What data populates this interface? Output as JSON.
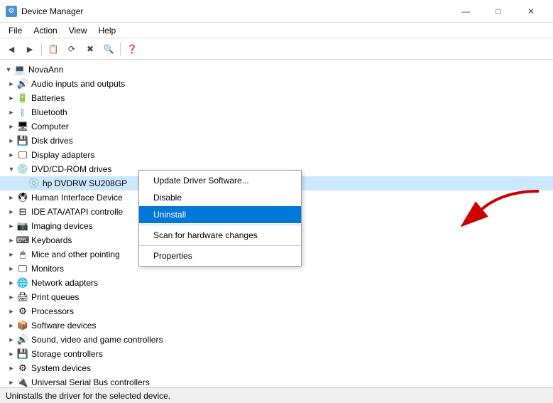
{
  "titleBar": {
    "title": "Device Manager",
    "iconSymbol": "⚙",
    "minimize": "—",
    "maximize": "□",
    "close": "✕"
  },
  "menuBar": {
    "items": [
      "File",
      "Action",
      "View",
      "Help"
    ]
  },
  "toolbar": {
    "buttons": [
      "←",
      "→",
      "⊡",
      "⊟",
      "⊞",
      "⊠",
      "↺",
      "⬛",
      "🖨",
      "⚙",
      "?"
    ]
  },
  "tree": {
    "items": [
      {
        "id": "novaann",
        "label": "NovaAnn",
        "indent": 0,
        "expand": "▼",
        "icon": "💻"
      },
      {
        "id": "audio",
        "label": "Audio inputs and outputs",
        "indent": 1,
        "expand": "►",
        "icon": "🔊"
      },
      {
        "id": "batteries",
        "label": "Batteries",
        "indent": 1,
        "expand": "►",
        "icon": "🔋"
      },
      {
        "id": "bluetooth",
        "label": "Bluetooth",
        "indent": 1,
        "expand": "►",
        "icon": "⬡"
      },
      {
        "id": "computer",
        "label": "Computer",
        "indent": 1,
        "expand": "►",
        "icon": "🖥"
      },
      {
        "id": "diskdrives",
        "label": "Disk drives",
        "indent": 1,
        "expand": "►",
        "icon": "💾"
      },
      {
        "id": "displayadapters",
        "label": "Display adapters",
        "indent": 1,
        "expand": "►",
        "icon": "🖵"
      },
      {
        "id": "dvdcdrom",
        "label": "DVD/CD-ROM drives",
        "indent": 1,
        "expand": "▼",
        "icon": "💿"
      },
      {
        "id": "hpdvdrw",
        "label": "hp DVDRW SU208GP",
        "indent": 2,
        "expand": " ",
        "icon": "💿",
        "selected": true
      },
      {
        "id": "hid",
        "label": "Human Interface Device",
        "indent": 1,
        "expand": "►",
        "icon": "🖲"
      },
      {
        "id": "ideata",
        "label": "IDE ATA/ATAPI controlle",
        "indent": 1,
        "expand": "►",
        "icon": "⊟"
      },
      {
        "id": "imaging",
        "label": "Imaging devices",
        "indent": 1,
        "expand": "►",
        "icon": "📷"
      },
      {
        "id": "keyboards",
        "label": "Keyboards",
        "indent": 1,
        "expand": "►",
        "icon": "⌨"
      },
      {
        "id": "mice",
        "label": "Mice and other pointing",
        "indent": 1,
        "expand": "►",
        "icon": "🖱"
      },
      {
        "id": "monitors",
        "label": "Monitors",
        "indent": 1,
        "expand": "►",
        "icon": "🖵"
      },
      {
        "id": "network",
        "label": "Network adapters",
        "indent": 1,
        "expand": "►",
        "icon": "🌐"
      },
      {
        "id": "printqueues",
        "label": "Print queues",
        "indent": 1,
        "expand": "►",
        "icon": "🖨"
      },
      {
        "id": "processors",
        "label": "Processors",
        "indent": 1,
        "expand": "►",
        "icon": "⚙"
      },
      {
        "id": "software",
        "label": "Software devices",
        "indent": 1,
        "expand": "►",
        "icon": "📦"
      },
      {
        "id": "sound",
        "label": "Sound, video and game controllers",
        "indent": 1,
        "expand": "►",
        "icon": "🔊"
      },
      {
        "id": "storage",
        "label": "Storage controllers",
        "indent": 1,
        "expand": "►",
        "icon": "💾"
      },
      {
        "id": "system",
        "label": "System devices",
        "indent": 1,
        "expand": "►",
        "icon": "⚙"
      },
      {
        "id": "usb",
        "label": "Universal Serial Bus controllers",
        "indent": 1,
        "expand": "►",
        "icon": "🔌"
      }
    ]
  },
  "contextMenu": {
    "items": [
      {
        "id": "update-driver",
        "label": "Update Driver Software...",
        "highlighted": false
      },
      {
        "id": "disable",
        "label": "Disable",
        "highlighted": false
      },
      {
        "id": "uninstall",
        "label": "Uninstall",
        "highlighted": true
      },
      {
        "id": "scan",
        "label": "Scan for hardware changes",
        "highlighted": false
      },
      {
        "id": "properties",
        "label": "Properties",
        "highlighted": false
      }
    ]
  },
  "statusBar": {
    "text": "Uninstalls the driver for the selected device."
  },
  "colors": {
    "selectedBg": "#cce8ff",
    "highlightBg": "#0078d7",
    "highlightText": "#ffffff"
  }
}
